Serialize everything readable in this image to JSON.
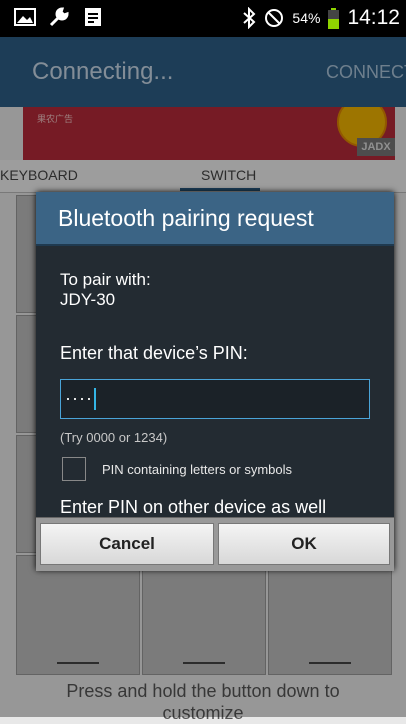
{
  "status_bar": {
    "battery": "54%",
    "time": "14:12"
  },
  "action_bar": {
    "title": "Connecting...",
    "connect_label": "CONNECT"
  },
  "ad": {
    "text": "果农广告",
    "badge": "JADX"
  },
  "tabs": [
    {
      "label": "KEYBOARD"
    },
    {
      "label": "SWITCH",
      "selected": true
    }
  ],
  "hint": "Press and hold the button down to customize",
  "dialog": {
    "title": "Bluetooth pairing request",
    "pair_with_label": "To pair with:",
    "device_name": "JDY-30",
    "pin_prompt": "Enter that device’s PIN:",
    "pin_value": "····",
    "try_hint": "(Try 0000 or 1234)",
    "checkbox_label": "PIN containing letters or symbols",
    "checkbox_checked": false,
    "enter_other": "Enter PIN on other device as well",
    "cancel_label": "Cancel",
    "ok_label": "OK"
  },
  "colors": {
    "action_bar": "#2d5f86",
    "dialog_header": "#3b6485",
    "input_border": "#4aa4d8",
    "battery": "#8fd400"
  }
}
